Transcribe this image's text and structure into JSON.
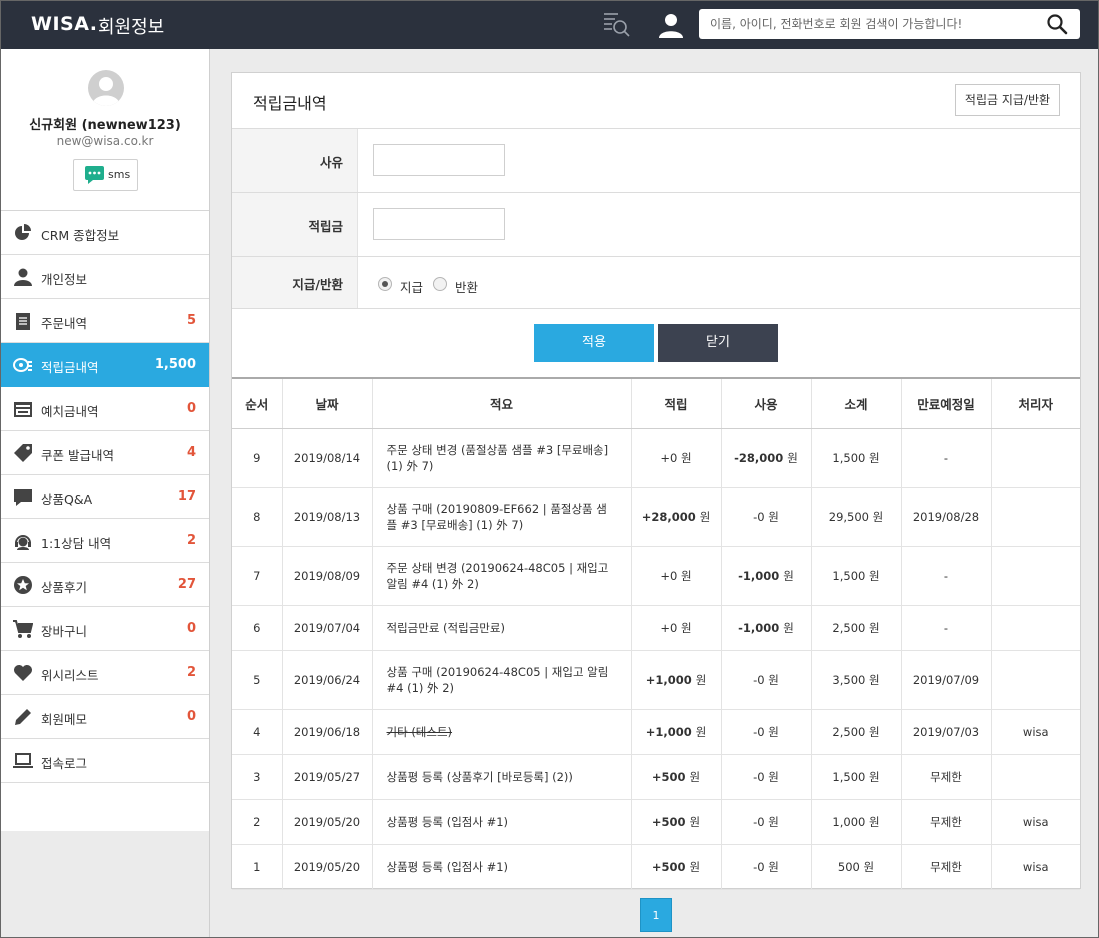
{
  "header": {
    "brand": "WISA.",
    "title": "회원정보",
    "search_placeholder": "이름, 아이디, 전화번호로 회원 검색이 가능합니다!"
  },
  "profile": {
    "name": "신규회원 (newnew123)",
    "email": "new@wisa.co.kr",
    "sms_label": "sms"
  },
  "sidebar": {
    "items": [
      {
        "label": "CRM 종합정보",
        "count": "",
        "icon": "pie-chart-icon"
      },
      {
        "label": "개인정보",
        "count": "",
        "icon": "person-icon"
      },
      {
        "label": "주문내역",
        "count": "5",
        "icon": "document-icon"
      },
      {
        "label": "적립금내역",
        "count": "1,500",
        "icon": "coins-icon"
      },
      {
        "label": "예치금내역",
        "count": "0",
        "icon": "safe-icon"
      },
      {
        "label": "쿠폰 발급내역",
        "count": "4",
        "icon": "tag-icon"
      },
      {
        "label": "상품Q&A",
        "count": "17",
        "icon": "chat-icon"
      },
      {
        "label": "1:1상담 내역",
        "count": "2",
        "icon": "headset-icon"
      },
      {
        "label": "상품후기",
        "count": "27",
        "icon": "star-icon"
      },
      {
        "label": "장바구니",
        "count": "0",
        "icon": "cart-icon"
      },
      {
        "label": "위시리스트",
        "count": "2",
        "icon": "heart-icon"
      },
      {
        "label": "회원메모",
        "count": "0",
        "icon": "pencil-icon"
      },
      {
        "label": "접속로그",
        "count": "",
        "icon": "laptop-icon"
      }
    ],
    "active_index": 3
  },
  "main": {
    "title": "적립금내역",
    "grant_button": "적립금 지급/반환",
    "form": {
      "reason_label": "사유",
      "amount_label": "적립금",
      "type_label": "지급/반환",
      "option_give": "지급",
      "option_return": "반환",
      "selected": "지급",
      "reason_value": "",
      "amount_value": ""
    },
    "apply_button": "적용",
    "close_button": "닫기",
    "table": {
      "headers": [
        "순서",
        "날짜",
        "적요",
        "적립",
        "사용",
        "소계",
        "만료예정일",
        "처리자"
      ],
      "rows": [
        {
          "no": "9",
          "date": "2019/08/14",
          "desc": "주문 상태 변경 (품절상품 샘플 #3 [무료배송] (1) 外 7)",
          "earn": "+0",
          "use": "-28,000",
          "subtotal": "1,500 원",
          "expire": "-",
          "handler": "",
          "strike": false
        },
        {
          "no": "8",
          "date": "2019/08/13",
          "desc": "상품 구매 (20190809-EF662 | 품절상품 샘플 #3 [무료배송] (1) 外 7)",
          "earn": "+28,000",
          "use": "-0",
          "subtotal": "29,500 원",
          "expire": "2019/08/28",
          "handler": "",
          "strike": false
        },
        {
          "no": "7",
          "date": "2019/08/09",
          "desc": "주문 상태 변경 (20190624-48C05 | 재입고 알림 #4 (1) 外 2)",
          "earn": "+0",
          "use": "-1,000",
          "subtotal": "1,500 원",
          "expire": "-",
          "handler": "",
          "strike": false
        },
        {
          "no": "6",
          "date": "2019/07/04",
          "desc": "적립금만료 (적립금만료)",
          "earn": "+0",
          "use": "-1,000",
          "subtotal": "2,500 원",
          "expire": "-",
          "handler": "",
          "strike": false
        },
        {
          "no": "5",
          "date": "2019/06/24",
          "desc": "상품 구매 (20190624-48C05 | 재입고 알림 #4 (1) 外 2)",
          "earn": "+1,000",
          "use": "-0",
          "subtotal": "3,500 원",
          "expire": "2019/07/09",
          "handler": "",
          "strike": false
        },
        {
          "no": "4",
          "date": "2019/06/18",
          "desc": "기타 (테스트)",
          "earn": "+1,000",
          "use": "-0",
          "subtotal": "2,500 원",
          "expire": "2019/07/03",
          "handler": "wisa",
          "strike": true
        },
        {
          "no": "3",
          "date": "2019/05/27",
          "desc": "상품평 등록 (상품후기 [바로등록] (2))",
          "earn": "+500",
          "use": "-0",
          "subtotal": "1,500 원",
          "expire": "무제한",
          "handler": "",
          "strike": false
        },
        {
          "no": "2",
          "date": "2019/05/20",
          "desc": "상품평 등록 (입점사 #1)",
          "earn": "+500",
          "use": "-0",
          "subtotal": "1,000 원",
          "expire": "무제한",
          "handler": "wisa",
          "strike": false
        },
        {
          "no": "1",
          "date": "2019/05/20",
          "desc": "상품평 등록 (입점사 #1)",
          "earn": "+500",
          "use": "-0",
          "subtotal": "500 원",
          "expire": "무제한",
          "handler": "wisa",
          "strike": false
        }
      ],
      "unit": "원"
    },
    "pagination": {
      "current": "1"
    }
  },
  "colors": {
    "accent": "#2aa9e0",
    "header_bg": "#2b313d",
    "count_red": "#e2553a",
    "dark_button": "#3c4250"
  }
}
